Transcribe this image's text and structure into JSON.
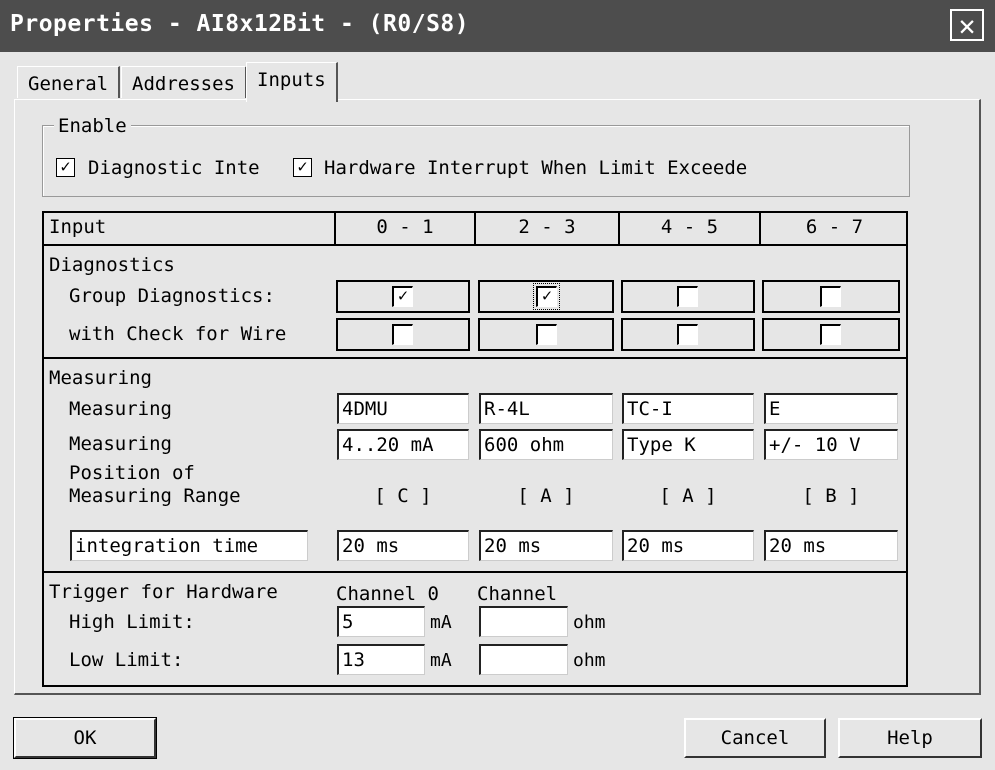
{
  "window": {
    "title": "Properties - AI8x12Bit - (R0/S8)",
    "close_symbol": "✕"
  },
  "tabs": [
    {
      "label": "General"
    },
    {
      "label": "Addresses"
    },
    {
      "label": "Inputs"
    }
  ],
  "enable": {
    "legend": "Enable",
    "diagnostic_label": "Diagnostic Inte",
    "diagnostic_checked": true,
    "hardware_label": "Hardware Interrupt When Limit Exceede",
    "hardware_checked": true
  },
  "table": {
    "input_header": "Input",
    "column_headers": [
      "0 - 1",
      "2 - 3",
      "4 - 5",
      "6 - 7"
    ],
    "diagnostics": {
      "title": "Diagnostics",
      "group_label": "Group Diagnostics:",
      "wire_label": "with Check for Wire",
      "check_mark": "✓",
      "group_checked": [
        true,
        true,
        false,
        false
      ],
      "wire_checked": [
        false,
        false,
        false,
        false
      ]
    },
    "measuring": {
      "title": "Measuring",
      "type_label": "Measuring",
      "type_values": [
        "4DMU",
        "R-4L",
        "TC-I",
        "E"
      ],
      "range_label": "Measuring",
      "range_values": [
        "4..20 mA",
        "600 ohm",
        "Type K",
        "+/- 10 V"
      ],
      "position_label_1": "Position of",
      "position_label_2": "Measuring Range",
      "position_values": [
        "[ C ]",
        "[ A ]",
        "[ A ]",
        "[ B ]"
      ],
      "integration_label": "integration time",
      "integration_values": [
        "20 ms",
        "20 ms",
        "20 ms",
        "20 ms"
      ]
    },
    "trigger": {
      "title": "Trigger for Hardware",
      "channel0_label": "Channel 0",
      "channel_label": "Channel",
      "high_label": "High Limit:",
      "low_label": "Low Limit:",
      "ch0_high": "5",
      "ch0_low": "13",
      "ch0_unit": "mA",
      "ch_high": "",
      "ch_low": "",
      "ch_unit": "ohm"
    }
  },
  "buttons": {
    "ok": "OK",
    "cancel": "Cancel",
    "help": "Help"
  }
}
